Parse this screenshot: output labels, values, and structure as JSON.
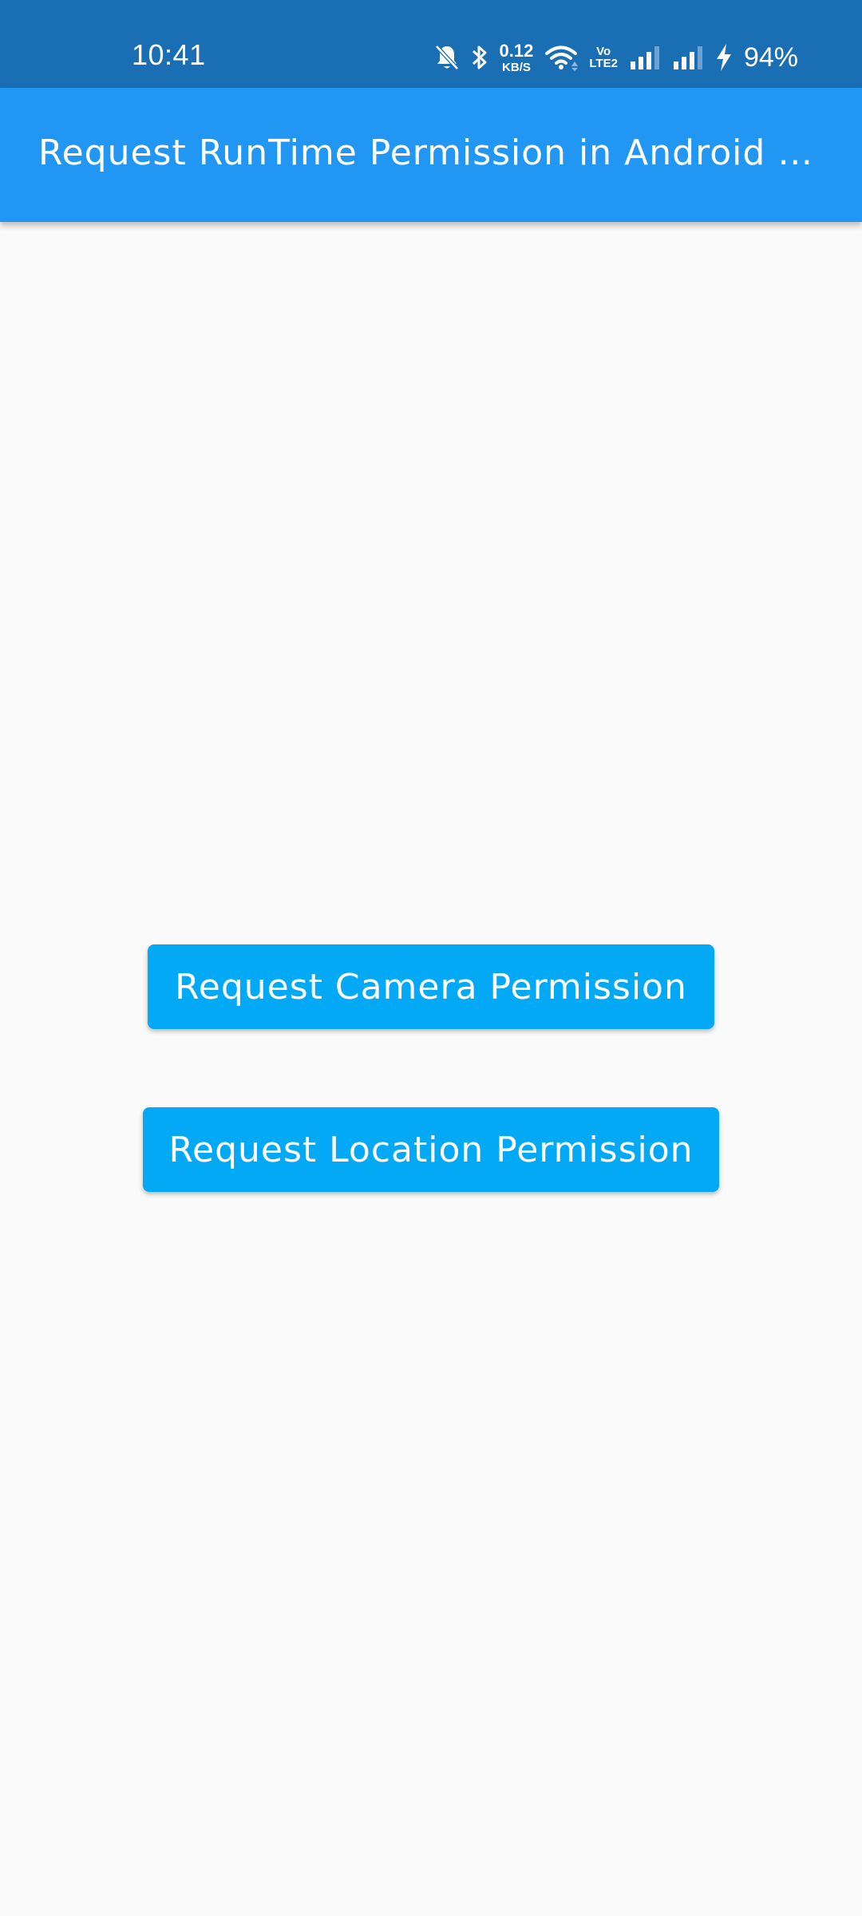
{
  "status_bar": {
    "time": "10:41",
    "net_speed_value": "0.12",
    "net_speed_unit": "KB/S",
    "volte_top": "Vo",
    "volte_bottom": "LTE2",
    "battery": "94%",
    "icons": [
      "bell-off-icon",
      "bluetooth-icon",
      "wifi-icon",
      "signal-icon",
      "signal-icon",
      "charging-icon"
    ],
    "colors": {
      "background": "#1a6fb4",
      "foreground": "#ffffff"
    }
  },
  "app_bar": {
    "title": "Request RunTime Permission in Android Flutter",
    "colors": {
      "background": "#2196f3",
      "foreground": "#ffffff"
    }
  },
  "main": {
    "buttons": [
      {
        "label": "Request Camera Permission"
      },
      {
        "label": "Request Location Permission"
      }
    ],
    "colors": {
      "background": "#fafafa",
      "button": "#03a9f4",
      "button_text": "#ffffff"
    }
  }
}
